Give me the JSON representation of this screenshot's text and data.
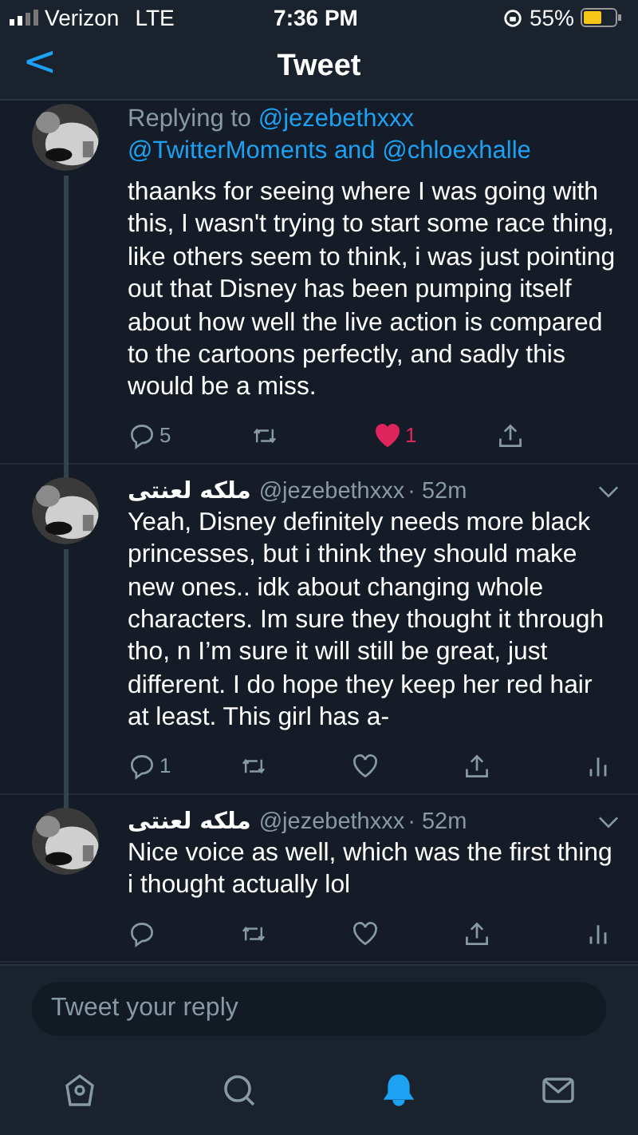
{
  "status_bar": {
    "carrier": "Verizon",
    "network": "LTE",
    "time": "7:36 PM",
    "battery": "55%"
  },
  "header": {
    "back": "<",
    "title": "Tweet"
  },
  "parent_tweet": {
    "replying_label": "Replying to",
    "mentions": [
      "@jezebethxxx",
      "@TwitterMoments",
      "@chloexhalle"
    ],
    "joiner": "and",
    "body": "thaanks for seeing where I was going with this, I wasn't trying to start some race thing, like others seem to think, i was just pointing out that Disney has been pumping itself about how well the live action is compared to the cartoons perfectly, and sadly this would be a miss.",
    "reply_count": "5",
    "like_count": "1",
    "liked": true
  },
  "replies": [
    {
      "name": "ملكه لعنتى",
      "handle": "@jezebethxxx",
      "time": "· 52m",
      "thread_line": true,
      "body": "Yeah, Disney definitely needs more black princesses, but i think they should make new ones.. idk about changing whole characters. Im sure they thought it through tho, n I’m sure it will still be great, just different. I do hope they keep her red hair at least. This girl has a-",
      "reply_count": "1",
      "liked": false
    },
    {
      "name": "ملكه لعنتى",
      "handle": "@jezebethxxx",
      "time": "· 52m",
      "thread_line": false,
      "body": "Nice voice as well, which was the first thing i thought actually lol",
      "liked": false
    }
  ],
  "reply_field": {
    "placeholder": "Tweet your reply"
  },
  "tabs": [
    {
      "kind": "home",
      "selected": false
    },
    {
      "kind": "search",
      "selected": false
    },
    {
      "kind": "notifications",
      "selected": true
    },
    {
      "kind": "messages",
      "selected": false
    }
  ]
}
